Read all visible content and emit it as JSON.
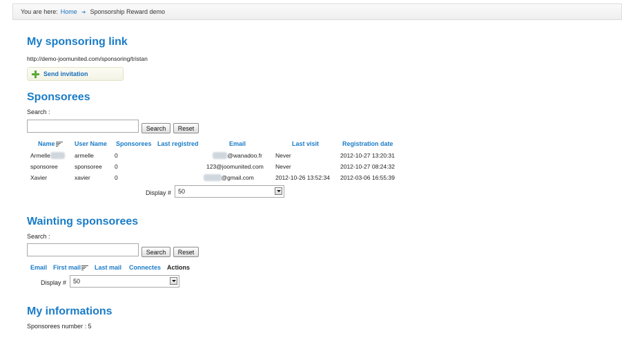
{
  "breadcrumb": {
    "prefix": "You are here:",
    "home": "Home",
    "current": "Sponsorship Reward demo"
  },
  "link_section": {
    "title": "My sponsoring link",
    "url": "http://demo-joomunited.com/sponsoring/tristan",
    "invite_label": "Send invitation"
  },
  "sponsorees": {
    "title": "Sponsorees",
    "search_label": "Search :",
    "search_value": "",
    "search_button": "Search",
    "reset_button": "Reset",
    "headers": [
      "Name",
      "User Name",
      "Sponsorees",
      "Last registred",
      "Email",
      "Last visit",
      "Registration date"
    ],
    "rows": [
      [
        "Armelle",
        "armelle",
        "0",
        "",
        "@wanadoo.fr",
        "Never",
        "2012-10-27 13:20:31"
      ],
      [
        "sponsoree",
        "sponsoree",
        "0",
        "",
        "123@joomunited.com",
        "Never",
        "2012-10-27 08:24:32"
      ],
      [
        "Xavier",
        "xavier",
        "0",
        "",
        "@gmail.com",
        "2012-10-26 13:52:34",
        "2012-03-06 16:55:39"
      ]
    ],
    "display_label": "Display #",
    "display_value": "50"
  },
  "waiting": {
    "title": "Wainting sponsorees",
    "search_label": "Search :",
    "search_value": "",
    "search_button": "Search",
    "reset_button": "Reset",
    "headers": [
      "Email",
      "First mail",
      "Last mail",
      "Connectes",
      "Actions"
    ],
    "display_label": "Display #",
    "display_value": "50"
  },
  "info": {
    "title": "My informations",
    "count_text": "Sponsorees number : 5"
  },
  "colors": {
    "accent": "#1a7cc7",
    "link": "#1a6fbd",
    "plus": "#5aa83a"
  }
}
